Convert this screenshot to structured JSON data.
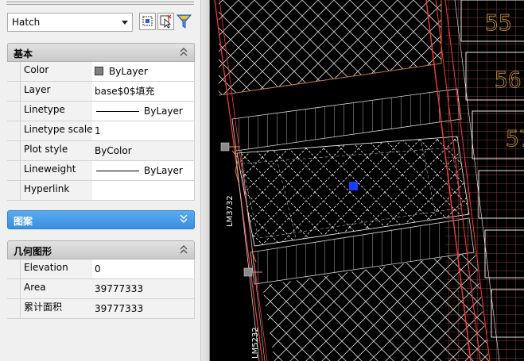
{
  "selector": {
    "value": "Hatch"
  },
  "toolbar": {
    "icons": [
      "quick-select-icon",
      "select-objects-icon",
      "filter-icon"
    ]
  },
  "general": {
    "title": "基本",
    "rows": [
      {
        "label": "Color",
        "value": "ByLayer"
      },
      {
        "label": "Layer",
        "value": "base$0$填充"
      },
      {
        "label": "Linetype",
        "value": "ByLayer"
      },
      {
        "label": "Linetype scale",
        "value": "1"
      },
      {
        "label": "Plot style",
        "value": "ByColor"
      },
      {
        "label": "Lineweight",
        "value": "ByLayer"
      },
      {
        "label": "Hyperlink",
        "value": ""
      }
    ]
  },
  "pattern": {
    "title": "图案"
  },
  "geometry": {
    "title": "几何图形",
    "rows": [
      {
        "label": "Elevation",
        "value": "0"
      },
      {
        "label": "Area",
        "value": "39777333"
      },
      {
        "label": "累计面积",
        "value": "39777333"
      }
    ]
  },
  "drawing": {
    "labels": [
      "LM3732",
      "LM5232"
    ],
    "room_numbers": [
      "55",
      "56",
      "57"
    ],
    "colors": {
      "background": "#000000",
      "hatch": "#e6e6e6",
      "red": "#ff3b3b",
      "orange": "#c87a3a",
      "grip": "#1a3cff"
    }
  }
}
